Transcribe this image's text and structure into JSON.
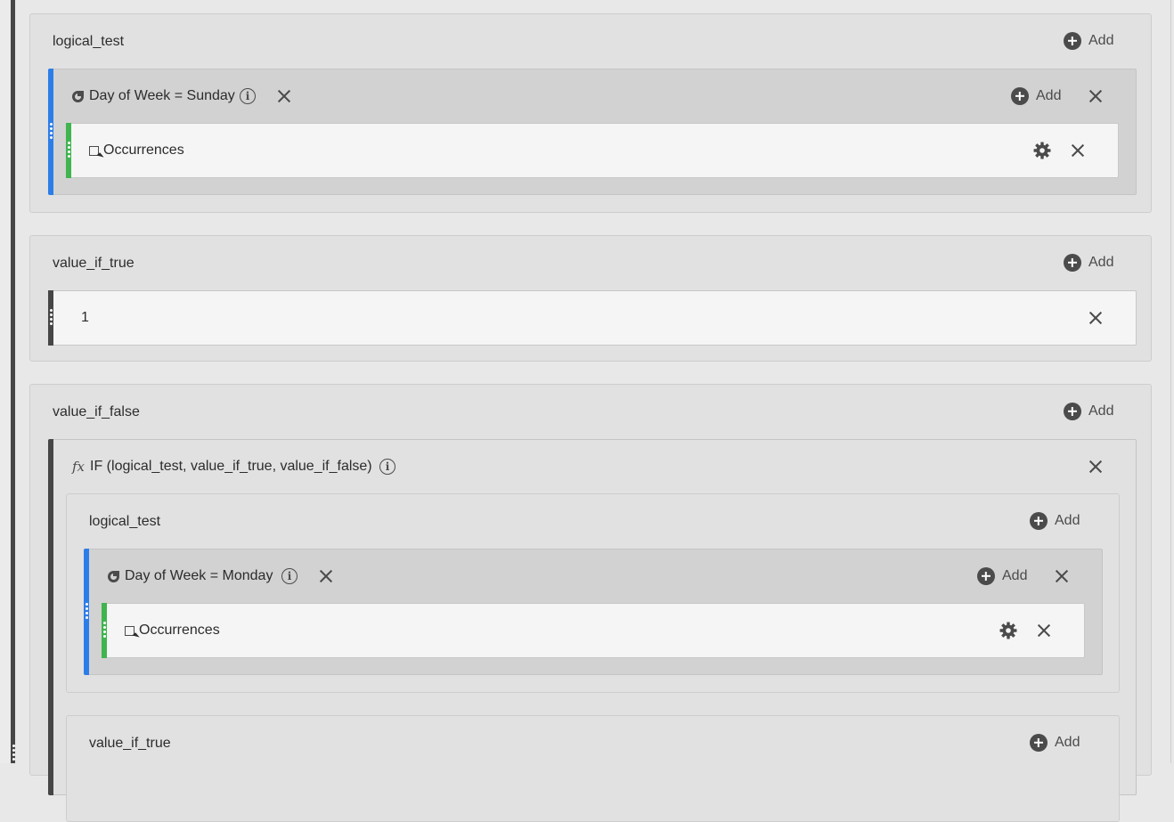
{
  "add_label": "Add",
  "sections": {
    "logical_test": {
      "label": "logical_test",
      "segment": {
        "title": "Day of Week = Sunday",
        "metric": "Occurrences"
      }
    },
    "value_if_true": {
      "label": "value_if_true",
      "value": "1"
    },
    "value_if_false": {
      "label": "value_if_false",
      "function": {
        "title": "IF (logical_test, value_if_true, value_if_false)",
        "logical_test": {
          "label": "logical_test",
          "segment": {
            "title": "Day of Week = Monday",
            "metric": "Occurrences"
          }
        },
        "value_if_true": {
          "label": "value_if_true"
        }
      }
    }
  },
  "icons": [
    "plus-circle-icon",
    "close-icon",
    "info-icon",
    "segment-icon",
    "metric-icon",
    "gear-icon",
    "fx-icon",
    "drag-handle-icon"
  ],
  "colors": {
    "segment_accent": "#2d7de9",
    "metric_accent": "#3fb44f",
    "static_accent": "#464646"
  }
}
